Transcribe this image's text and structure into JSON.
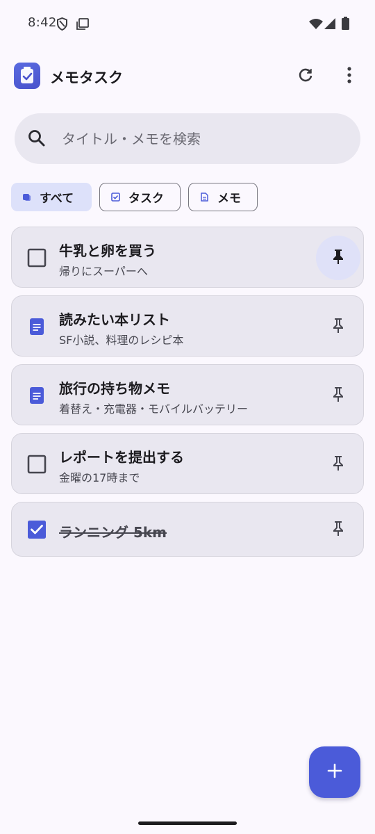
{
  "status_bar": {
    "time": "8:42",
    "icons": [
      "shield-icon",
      "screenshot-icon",
      "wifi-icon",
      "signal-icon",
      "battery-icon"
    ]
  },
  "app_bar": {
    "title": "メモタスク",
    "actions": [
      "refresh-icon",
      "more-vert-icon"
    ]
  },
  "search": {
    "placeholder": "タイトル・メモを検索",
    "value": ""
  },
  "filters": [
    {
      "label": "すべて",
      "selected": true,
      "icon": "all-icon"
    },
    {
      "label": "タスク",
      "selected": false,
      "icon": "task-icon"
    },
    {
      "label": "メモ",
      "selected": false,
      "icon": "memo-icon"
    }
  ],
  "items": [
    {
      "type": "task",
      "title": "牛乳と卵を買う",
      "subtitle": "帰りにスーパーへ",
      "checked": false,
      "pinned": true
    },
    {
      "type": "memo",
      "title": "読みたい本リスト",
      "subtitle": "SF小説、料理のレシピ本",
      "checked": false,
      "pinned": false
    },
    {
      "type": "memo",
      "title": "旅行の持ち物メモ",
      "subtitle": "着替え・充電器・モバイルバッテリー",
      "checked": false,
      "pinned": false
    },
    {
      "type": "task",
      "title": "レポートを提出する",
      "subtitle": "金曜の17時まで",
      "checked": false,
      "pinned": false
    },
    {
      "type": "task",
      "title": "ランニング 5km",
      "subtitle": "",
      "checked": true,
      "pinned": false
    }
  ],
  "fab": {
    "icon": "add-icon"
  },
  "colors": {
    "accent": "#4b5bd9",
    "background": "#fbf8fe",
    "card": "#e9e7f0",
    "chip_selected": "#dde1fa",
    "pin_active_bg": "#dfe1f8"
  }
}
